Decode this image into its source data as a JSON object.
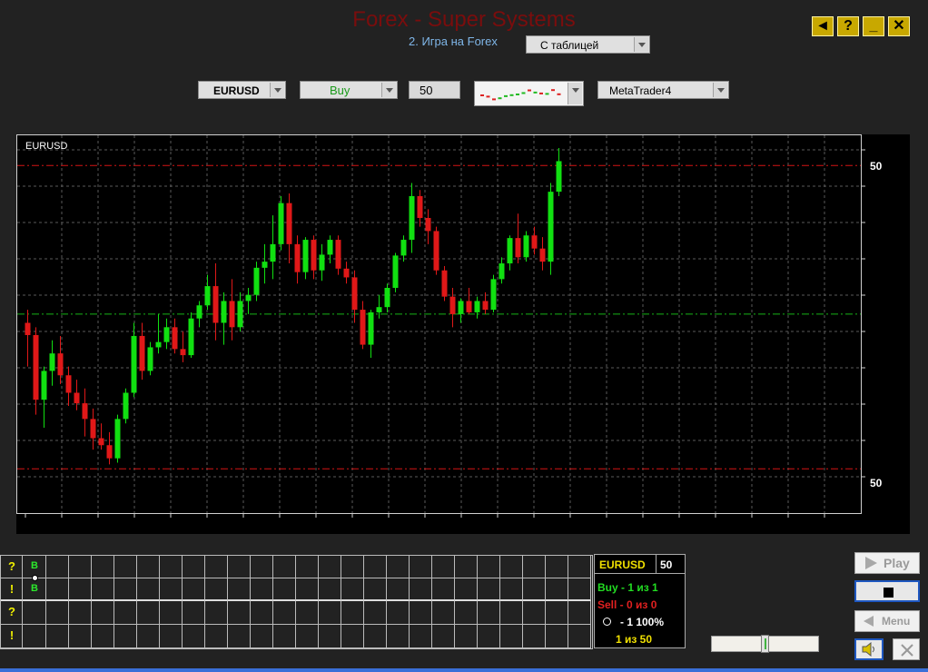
{
  "header": {
    "title": "Forex - Super Systems",
    "subtitle": "2. Игра на Forex",
    "mode_select": "С таблицей",
    "buttons": {
      "back": "◄",
      "help": "?",
      "minimize": "_",
      "close": "✕"
    }
  },
  "toolbar": {
    "symbol": "EURUSD",
    "direction": "Buy",
    "direction_color": "#1a9a1a",
    "lot": "50",
    "platform": "MetaTrader4"
  },
  "chart": {
    "symbol_label": "EURUSD",
    "upper_level_label": "50",
    "lower_level_label": "50"
  },
  "chart_data": {
    "type": "candlestick",
    "title": "EURUSD",
    "candles": [
      {
        "o": 200,
        "h": 215,
        "l": 150,
        "c": 186
      },
      {
        "o": 186,
        "h": 195,
        "l": 95,
        "c": 112
      },
      {
        "o": 112,
        "h": 150,
        "l": 80,
        "c": 145
      },
      {
        "o": 145,
        "h": 180,
        "l": 128,
        "c": 165
      },
      {
        "o": 165,
        "h": 185,
        "l": 130,
        "c": 140
      },
      {
        "o": 140,
        "h": 150,
        "l": 105,
        "c": 120
      },
      {
        "o": 120,
        "h": 135,
        "l": 100,
        "c": 108
      },
      {
        "o": 108,
        "h": 125,
        "l": 70,
        "c": 90
      },
      {
        "o": 90,
        "h": 102,
        "l": 55,
        "c": 68
      },
      {
        "o": 68,
        "h": 85,
        "l": 55,
        "c": 60
      },
      {
        "o": 60,
        "h": 75,
        "l": 38,
        "c": 45
      },
      {
        "o": 45,
        "h": 95,
        "l": 40,
        "c": 90
      },
      {
        "o": 90,
        "h": 125,
        "l": 85,
        "c": 120
      },
      {
        "o": 120,
        "h": 200,
        "l": 115,
        "c": 185
      },
      {
        "o": 185,
        "h": 200,
        "l": 135,
        "c": 145
      },
      {
        "o": 145,
        "h": 178,
        "l": 140,
        "c": 172
      },
      {
        "o": 172,
        "h": 210,
        "l": 165,
        "c": 178
      },
      {
        "o": 178,
        "h": 205,
        "l": 170,
        "c": 195
      },
      {
        "o": 195,
        "h": 205,
        "l": 165,
        "c": 170
      },
      {
        "o": 170,
        "h": 190,
        "l": 155,
        "c": 163
      },
      {
        "o": 163,
        "h": 212,
        "l": 160,
        "c": 205
      },
      {
        "o": 205,
        "h": 225,
        "l": 195,
        "c": 220
      },
      {
        "o": 220,
        "h": 255,
        "l": 215,
        "c": 242
      },
      {
        "o": 242,
        "h": 268,
        "l": 180,
        "c": 200
      },
      {
        "o": 200,
        "h": 235,
        "l": 175,
        "c": 225
      },
      {
        "o": 225,
        "h": 250,
        "l": 180,
        "c": 195
      },
      {
        "o": 195,
        "h": 235,
        "l": 190,
        "c": 225
      },
      {
        "o": 225,
        "h": 240,
        "l": 210,
        "c": 232
      },
      {
        "o": 232,
        "h": 270,
        "l": 225,
        "c": 263
      },
      {
        "o": 263,
        "h": 290,
        "l": 245,
        "c": 270
      },
      {
        "o": 270,
        "h": 323,
        "l": 250,
        "c": 290
      },
      {
        "o": 290,
        "h": 345,
        "l": 283,
        "c": 337
      },
      {
        "o": 337,
        "h": 348,
        "l": 268,
        "c": 290
      },
      {
        "o": 290,
        "h": 300,
        "l": 245,
        "c": 258
      },
      {
        "o": 258,
        "h": 298,
        "l": 250,
        "c": 295
      },
      {
        "o": 295,
        "h": 300,
        "l": 250,
        "c": 260
      },
      {
        "o": 260,
        "h": 290,
        "l": 248,
        "c": 278
      },
      {
        "o": 278,
        "h": 300,
        "l": 268,
        "c": 295
      },
      {
        "o": 295,
        "h": 300,
        "l": 255,
        "c": 262
      },
      {
        "o": 262,
        "h": 270,
        "l": 245,
        "c": 252
      },
      {
        "o": 252,
        "h": 260,
        "l": 200,
        "c": 215
      },
      {
        "o": 215,
        "h": 225,
        "l": 170,
        "c": 175
      },
      {
        "o": 175,
        "h": 215,
        "l": 160,
        "c": 212
      },
      {
        "o": 212,
        "h": 232,
        "l": 205,
        "c": 218
      },
      {
        "o": 218,
        "h": 245,
        "l": 212,
        "c": 240
      },
      {
        "o": 240,
        "h": 280,
        "l": 235,
        "c": 277
      },
      {
        "o": 277,
        "h": 300,
        "l": 270,
        "c": 295
      },
      {
        "o": 295,
        "h": 360,
        "l": 280,
        "c": 345
      },
      {
        "o": 345,
        "h": 352,
        "l": 310,
        "c": 320
      },
      {
        "o": 320,
        "h": 330,
        "l": 290,
        "c": 305
      },
      {
        "o": 305,
        "h": 310,
        "l": 255,
        "c": 260
      },
      {
        "o": 260,
        "h": 265,
        "l": 225,
        "c": 230
      },
      {
        "o": 230,
        "h": 240,
        "l": 195,
        "c": 210
      },
      {
        "o": 210,
        "h": 228,
        "l": 200,
        "c": 225
      },
      {
        "o": 225,
        "h": 240,
        "l": 210,
        "c": 212
      },
      {
        "o": 212,
        "h": 230,
        "l": 205,
        "c": 225
      },
      {
        "o": 225,
        "h": 235,
        "l": 210,
        "c": 215
      },
      {
        "o": 215,
        "h": 255,
        "l": 212,
        "c": 250
      },
      {
        "o": 250,
        "h": 275,
        "l": 245,
        "c": 268
      },
      {
        "o": 268,
        "h": 300,
        "l": 260,
        "c": 297
      },
      {
        "o": 297,
        "h": 325,
        "l": 268,
        "c": 275
      },
      {
        "o": 275,
        "h": 305,
        "l": 270,
        "c": 300
      },
      {
        "o": 300,
        "h": 310,
        "l": 278,
        "c": 285
      },
      {
        "o": 285,
        "h": 298,
        "l": 260,
        "c": 270
      },
      {
        "o": 270,
        "h": 360,
        "l": 255,
        "c": 350
      },
      {
        "o": 350,
        "h": 400,
        "l": 345,
        "c": 385
      }
    ],
    "levels": [
      {
        "value": 380,
        "color": "#d41414",
        "style": "dash-dot"
      },
      {
        "value": 210,
        "color": "#17b317",
        "style": "dash-dot"
      },
      {
        "value": 33,
        "color": "#d41414",
        "style": "dash-dot"
      }
    ],
    "ylim": [
      0,
      400
    ],
    "grid": true,
    "bull_color": "#11e011",
    "bear_color": "#e01818"
  },
  "table": {
    "row_marks": [
      "?",
      "!",
      "?",
      "!"
    ],
    "first_col": [
      "B",
      "B"
    ]
  },
  "info_panel": {
    "symbol": "EURUSD",
    "lot": "50",
    "buy": "Buy - 1 из 1",
    "sell": "Sell - 0 из 0",
    "ratio": "- 1 100%",
    "progress": "1 из 50"
  },
  "controls": {
    "play": "Play",
    "menu": "Menu",
    "volume_level": 0.5
  }
}
